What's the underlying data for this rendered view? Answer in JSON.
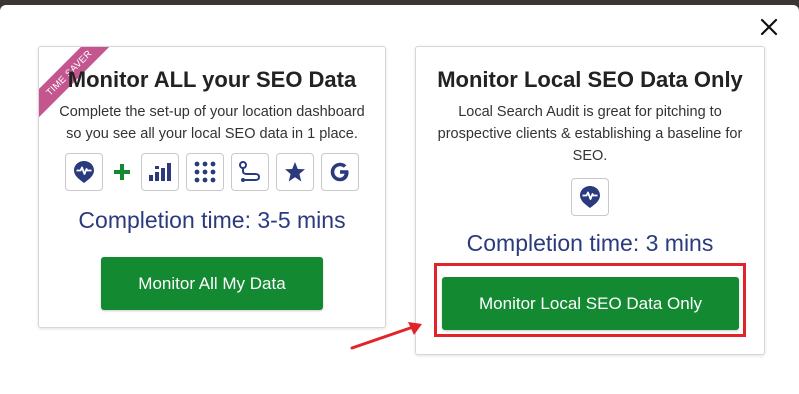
{
  "modal": {
    "close_icon": "close-icon"
  },
  "left_card": {
    "ribbon": "TIME SAVER",
    "title": "Monitor ALL your SEO Data",
    "description_line1": "Complete the set-up of your location dashboard",
    "description_line2": "so you see all your local SEO data in 1 place.",
    "icons": [
      "location-heartbeat-icon",
      "plus-icon",
      "bar-chart-icon",
      "grid-dots-icon",
      "route-icon",
      "star-icon",
      "google-icon"
    ],
    "completion": "Completion time: 3-5 mins",
    "button": "Monitor All My Data"
  },
  "right_card": {
    "title": "Monitor Local SEO Data Only",
    "description_line1": "Local Search Audit is great for pitching to",
    "description_line2": "prospective clients & establishing a baseline for",
    "description_line3": "SEO.",
    "icons": [
      "location-heartbeat-icon"
    ],
    "completion": "Completion time: 3 mins",
    "button": "Monitor Local SEO Data Only"
  },
  "colors": {
    "button_green": "#138a32",
    "completion_blue": "#2b3a7e",
    "icon_navy": "#2b3a7e",
    "ribbon_pink": "#c3568f",
    "highlight_red": "#e0242a"
  }
}
